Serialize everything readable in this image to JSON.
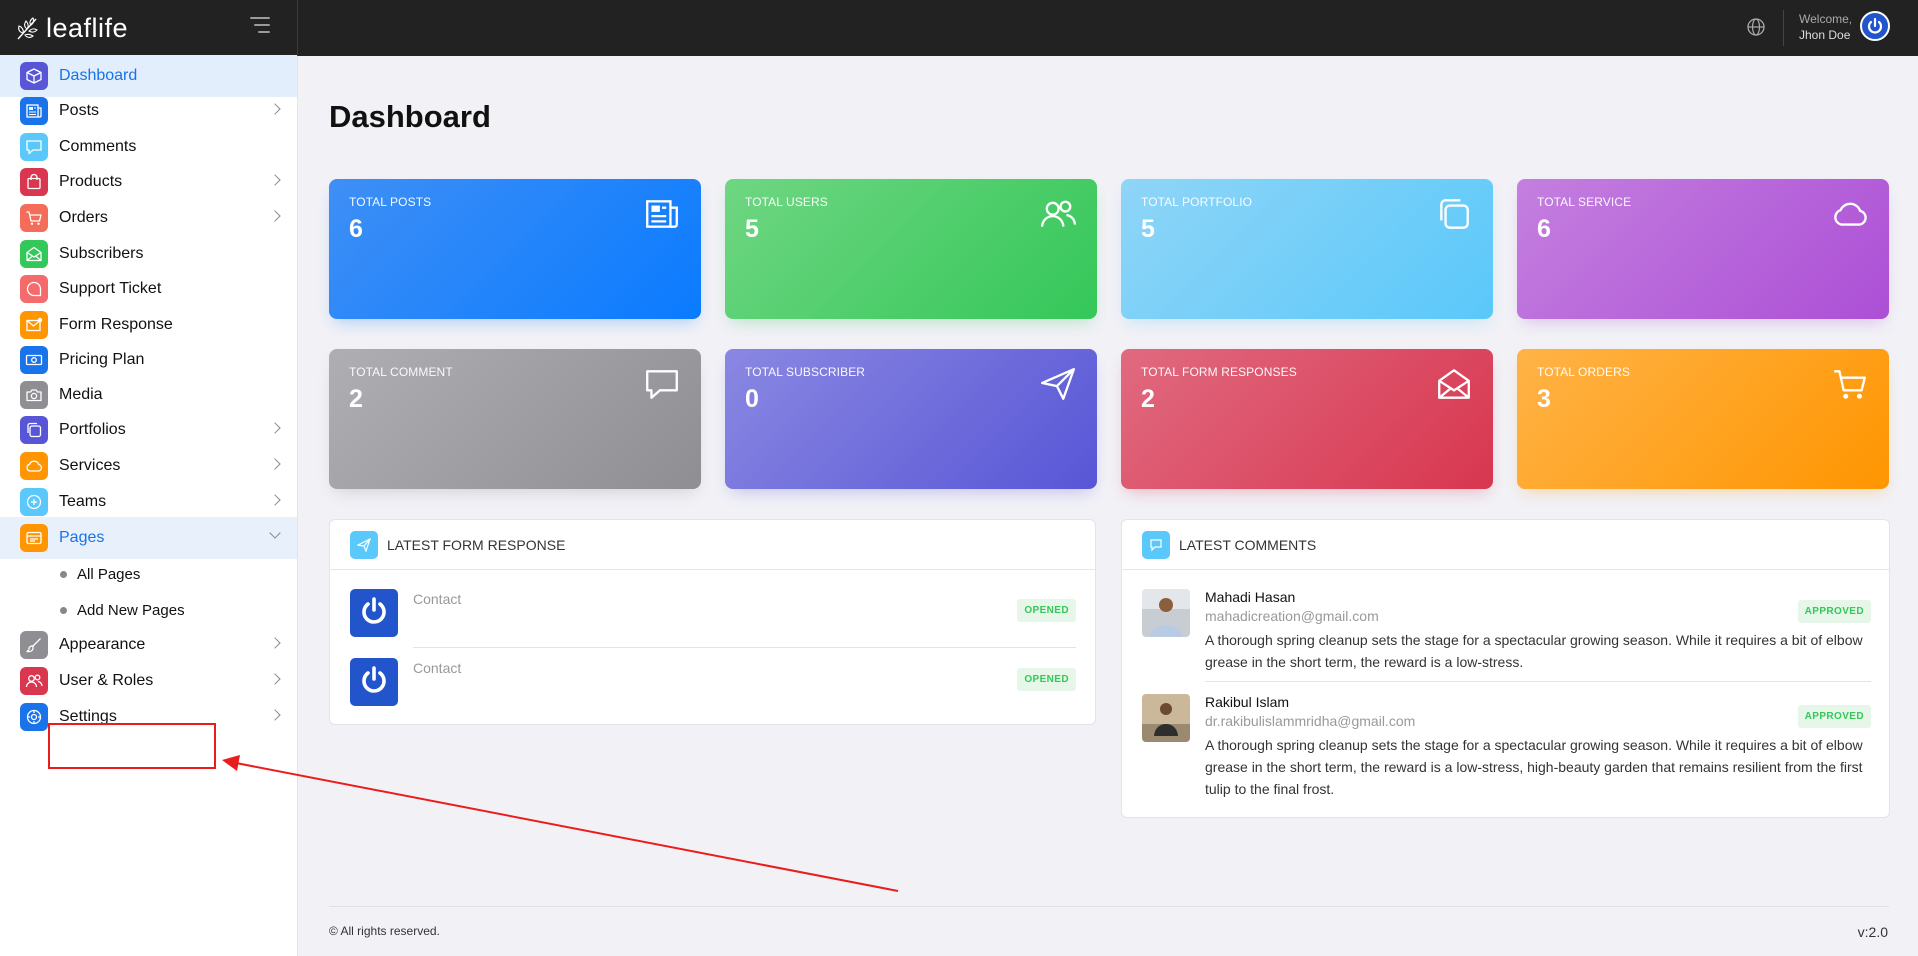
{
  "app": {
    "brand": "leaflife"
  },
  "header": {
    "welcome": "Welcome,",
    "user_name": "Jhon Doe"
  },
  "sidebar": {
    "items": [
      {
        "label": "Dashboard",
        "icon": "cube-icon",
        "color": "#5856d6"
      },
      {
        "label": "Posts",
        "icon": "newspaper-icon",
        "color": "#1a73e8"
      },
      {
        "label": "Comments",
        "icon": "chat-icon",
        "color": "#5ac8fa"
      },
      {
        "label": "Products",
        "icon": "bag-icon",
        "color": "#d9364f"
      },
      {
        "label": "Orders",
        "icon": "cart-icon",
        "color": "#f46c5a"
      },
      {
        "label": "Subscribers",
        "icon": "envelope-open-icon",
        "color": "#34c759"
      },
      {
        "label": "Support Ticket",
        "icon": "support-icon",
        "color": "#f56b6b"
      },
      {
        "label": "Form Response",
        "icon": "mail-badge-icon",
        "color": "#ff9500"
      },
      {
        "label": "Pricing Plan",
        "icon": "money-icon",
        "color": "#1a73e8"
      },
      {
        "label": "Media",
        "icon": "camera-icon",
        "color": "#8e8e93"
      },
      {
        "label": "Portfolios",
        "icon": "copy-icon",
        "color": "#5856d6"
      },
      {
        "label": "Services",
        "icon": "cloud-icon",
        "color": "#ff9500"
      },
      {
        "label": "Teams",
        "icon": "plus-circle-icon",
        "color": "#5ac8fa"
      },
      {
        "label": "Pages",
        "icon": "window-icon",
        "color": "#ff9500"
      },
      {
        "label": "Appearance",
        "icon": "brush-icon",
        "color": "#8e8e93"
      },
      {
        "label": "User & Roles",
        "icon": "users-icon",
        "color": "#d9364f"
      },
      {
        "label": "Settings",
        "icon": "gear-icon",
        "color": "#1a73e8"
      }
    ],
    "sub_items": [
      {
        "label": "All Pages"
      },
      {
        "label": "Add New Pages"
      }
    ]
  },
  "main": {
    "title": "Dashboard",
    "stats": [
      {
        "label": "TOTAL POSTS",
        "value": "6",
        "icon": "newspaper-icon"
      },
      {
        "label": "TOTAL USERS",
        "value": "5",
        "icon": "users-icon"
      },
      {
        "label": "TOTAL PORTFOLIO",
        "value": "5",
        "icon": "copy-icon"
      },
      {
        "label": "TOTAL SERVICE",
        "value": "6",
        "icon": "cloud-icon"
      },
      {
        "label": "TOTAL COMMENT",
        "value": "2",
        "icon": "chat-icon"
      },
      {
        "label": "TOTAL SUBSCRIBER",
        "value": "0",
        "icon": "send-icon"
      },
      {
        "label": "TOTAL FORM RESPONSES",
        "value": "2",
        "icon": "envelope-open-icon"
      },
      {
        "label": "TOTAL ORDERS",
        "value": "3",
        "icon": "cart-icon"
      }
    ],
    "latest_form": {
      "title": "LATEST FORM RESPONSE",
      "rows": [
        {
          "subject": "Contact",
          "status": "OPENED"
        },
        {
          "subject": "Contact",
          "status": "OPENED"
        }
      ]
    },
    "latest_comments": {
      "title": "LATEST COMMENTS",
      "rows": [
        {
          "name": "Mahadi Hasan",
          "email": "mahadicreation@gmail.com",
          "status": "APPROVED",
          "text": "A thorough spring cleanup sets the stage for a spectacular growing season. While it requires a bit of elbow grease in the short term, the reward is a low-stress."
        },
        {
          "name": "Rakibul Islam",
          "email": "dr.rakibulislammridha@gmail.com",
          "status": "APPROVED",
          "text": "A thorough spring cleanup sets the stage for a spectacular growing season. While it requires a bit of elbow grease in the short term, the reward is a low-stress, high-beauty garden that remains resilient from the first tulip to the final frost."
        }
      ]
    }
  },
  "footer": {
    "copyright": "© All rights reserved.",
    "version": "v:2.0"
  }
}
